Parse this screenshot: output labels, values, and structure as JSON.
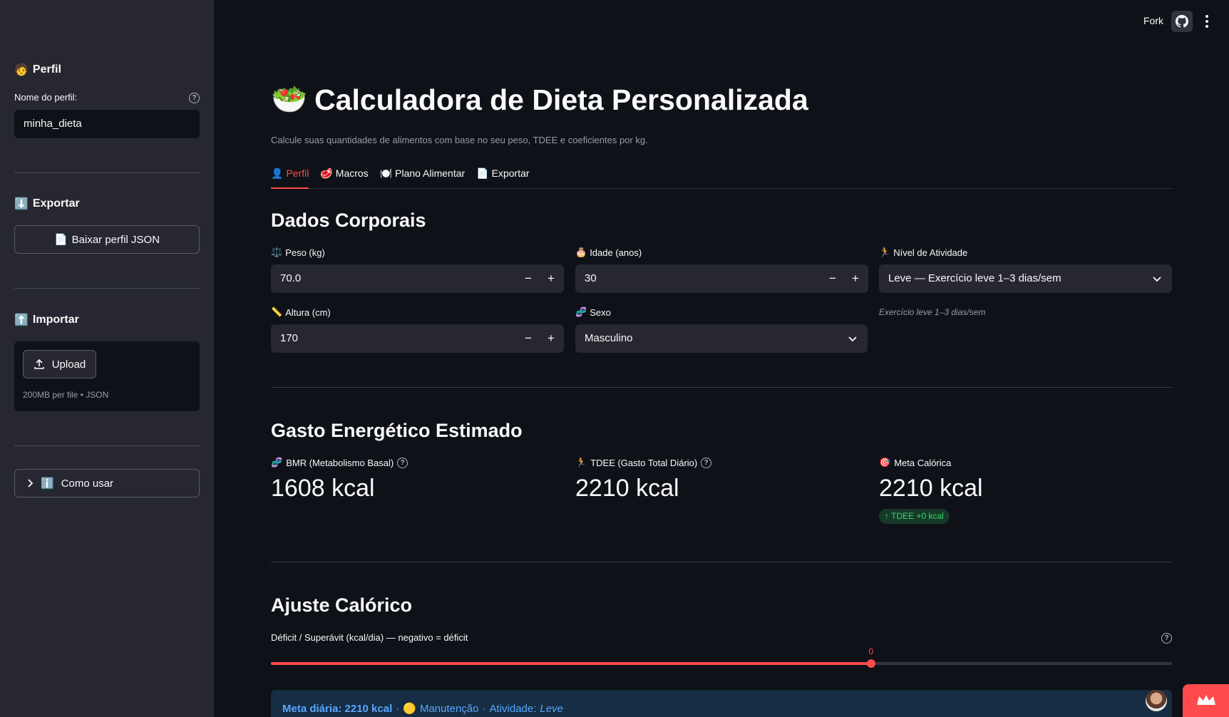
{
  "sidebar": {
    "profile_heading": "Perfil",
    "profile_icon": "🧑",
    "profile_name_label": "Nome do perfil:",
    "profile_name_value": "minha_dieta",
    "export_heading": "Exportar",
    "export_icon": "⬇️",
    "download_button": "Baixar perfil JSON",
    "download_icon": "📄",
    "import_heading": "Importar",
    "import_icon": "⬆️",
    "upload_button": "Upload",
    "upload_note": "200MB per file • JSON",
    "howto_label": "Como usar",
    "howto_icon": "ℹ️"
  },
  "topbar": {
    "fork_label": "Fork"
  },
  "header": {
    "title": "Calculadora de Dieta Personalizada",
    "title_icon": "🥗",
    "caption": "Calcule suas quantidades de alimentos com base no seu peso, TDEE e coeficientes por kg."
  },
  "tabs": [
    {
      "icon": "👤",
      "label": "Perfil",
      "active": true
    },
    {
      "icon": "🥩",
      "label": "Macros"
    },
    {
      "icon": "🍽️",
      "label": "Plano Alimentar"
    },
    {
      "icon": "📄",
      "label": "Exportar"
    }
  ],
  "body_data": {
    "heading": "Dados Corporais",
    "weight": {
      "icon": "⚖️",
      "label": "Peso (kg)",
      "value": "70.0"
    },
    "age": {
      "icon": "🎂",
      "label": "Idade (anos)",
      "value": "30"
    },
    "activity": {
      "icon": "🏃",
      "label": "Nível de Atividade",
      "value": "Leve — Exercício leve 1–3 dias/sem",
      "note": "Exercício leve 1–3 dias/sem"
    },
    "height": {
      "icon": "📏",
      "label": "Altura (cm)",
      "value": "170"
    },
    "sex": {
      "icon": "🧬",
      "label": "Sexo",
      "value": "Masculino"
    }
  },
  "energy": {
    "heading": "Gasto Energético Estimado",
    "bmr": {
      "icon": "🧬",
      "label": "BMR (Metabolismo Basal)",
      "value": "1608 kcal"
    },
    "tdee": {
      "icon": "🏃",
      "label": "TDEE (Gasto Total Diário)",
      "value": "2210 kcal"
    },
    "goal": {
      "icon": "🎯",
      "label": "Meta Calórica",
      "value": "2210 kcal",
      "delta": "TDEE +0 kcal"
    }
  },
  "adjust": {
    "heading": "Ajuste Calórico",
    "slider_label": "Déficit / Superávit (kcal/dia) — negativo = déficit",
    "slider_value": "0",
    "slider_fraction": 0.666
  },
  "info_bar": {
    "meta": "Meta diária: 2210 kcal",
    "sep1": "·",
    "status_icon": "🟡",
    "status": "Manutenção",
    "sep2": "·",
    "activity_prefix": "Atividade:",
    "activity": "Leve"
  },
  "colors": {
    "accent": "#ff4b4b",
    "background": "#0e1117",
    "sidebar": "#262730",
    "info": "#58a6ff"
  }
}
